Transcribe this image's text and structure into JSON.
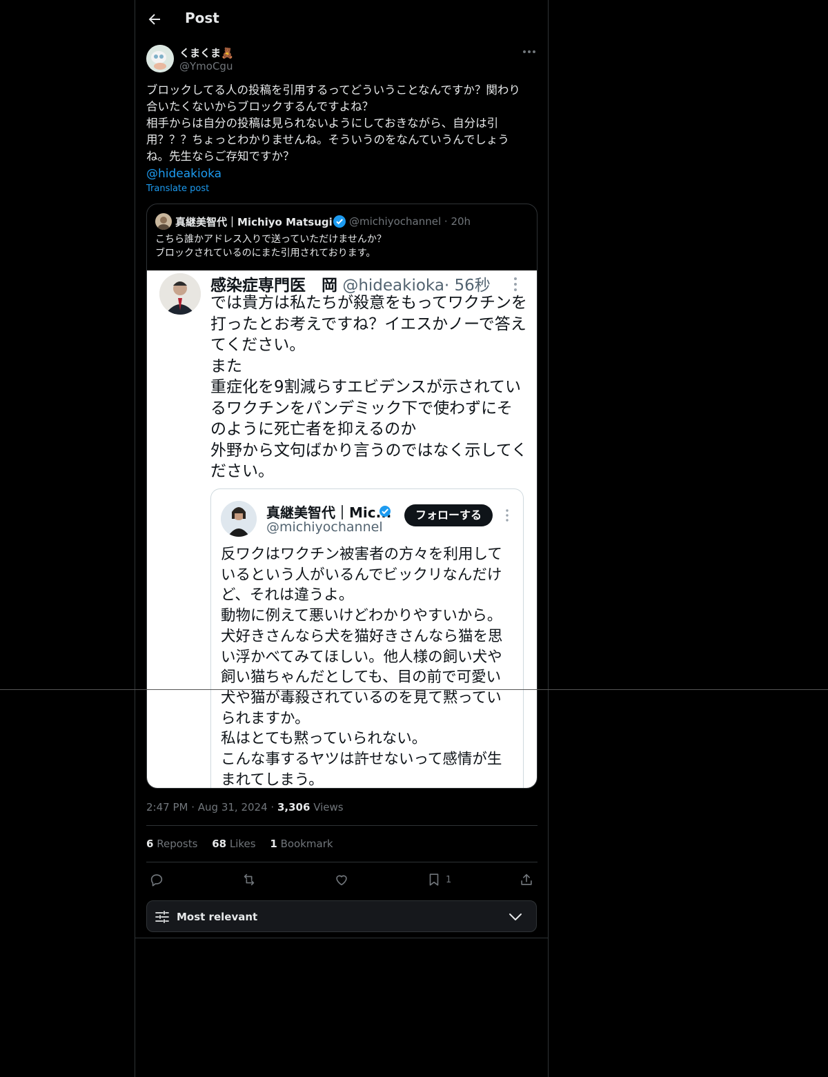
{
  "header": {
    "title": "Post"
  },
  "author": {
    "name": "くまくま🧸",
    "handle": "@YmoCgu"
  },
  "post": {
    "lines": [
      "ブロックしてる人の投稿を引用するってどういうことなんですか？関わり",
      "合いたくないからブロックするんですよね？",
      "相手からは自分の投稿は見られないようにしておきながら、自分は引",
      "用？？？ちょっとわかりませんね。そういうのをなんていうんでしょう",
      "ね。先生ならご存知ですか？"
    ],
    "mention": "@hideakioka",
    "translate_label": "Translate post"
  },
  "quote": {
    "name": "真継美智代｜Michiyo Matsugi",
    "handle": "@michiyochannel",
    "time": "· 20h",
    "lines": [
      "こちら誰かアドレス入りで送っていただけませんか？",
      "ブロックされているのにまた引用されております。"
    ],
    "screenshot": {
      "name": "感染症専門医　岡",
      "handle": "@hideakioka",
      "time": "· 56秒",
      "lines": [
        "では貴方は私たちが殺意をもってワクチンを",
        "打ったとお考えですね？イエスかノーで答え",
        "てください。",
        "また",
        "重症化を9割減らすエビデンスが示されてい",
        "るワクチンをパンデミック下で使わずにそ",
        "のように死亡者を抑えるのか",
        "外野から文句ばかり言うのではなく示してく",
        "ださい。"
      ],
      "card": {
        "name": "真継美智代｜Mic...",
        "handle": "@michiyochannel",
        "follow_label": "フォローする",
        "lines": [
          "反ワクはワクチン被害者の方々を利用して",
          "いるという人がいるんでビックリなんだけ",
          "ど、それは違うよ。",
          "動物に例えて悪いけどわかりやすいから。",
          "犬好きさんなら犬を猫好きさんなら猫を思",
          "い浮かべてみてほしい。他人様の飼い犬や",
          "飼い猫ちゃんだとしても、目の前で可愛い",
          "犬や猫が毒殺されているのを見て黙ってい",
          "られますか。",
          "私はとても黙っていられない。",
          "こんな事するヤツは許せないって感情が生",
          "まれてしまう。"
        ]
      }
    }
  },
  "meta": {
    "time": "2:47 PM",
    "date": "Aug 31, 2024",
    "views_count": "3,306",
    "views_label": "Views"
  },
  "stats": {
    "reposts_count": "6",
    "reposts_label": "Reposts",
    "likes_count": "68",
    "likes_label": "Likes",
    "bookmarks_count": "1",
    "bookmarks_label": "Bookmark"
  },
  "actions": {
    "bookmark_count": "1"
  },
  "sort": {
    "label": "Most relevant"
  },
  "colors": {
    "accent": "#1d9bf0",
    "background": "#000000",
    "muted": "#71767b",
    "text": "#e7e9ea"
  },
  "icons": [
    "back-arrow-icon",
    "more-icon",
    "verified-icon",
    "reply-icon",
    "repost-icon",
    "like-icon",
    "bookmark-icon",
    "share-icon",
    "sliders-icon",
    "chevron-down-icon"
  ]
}
